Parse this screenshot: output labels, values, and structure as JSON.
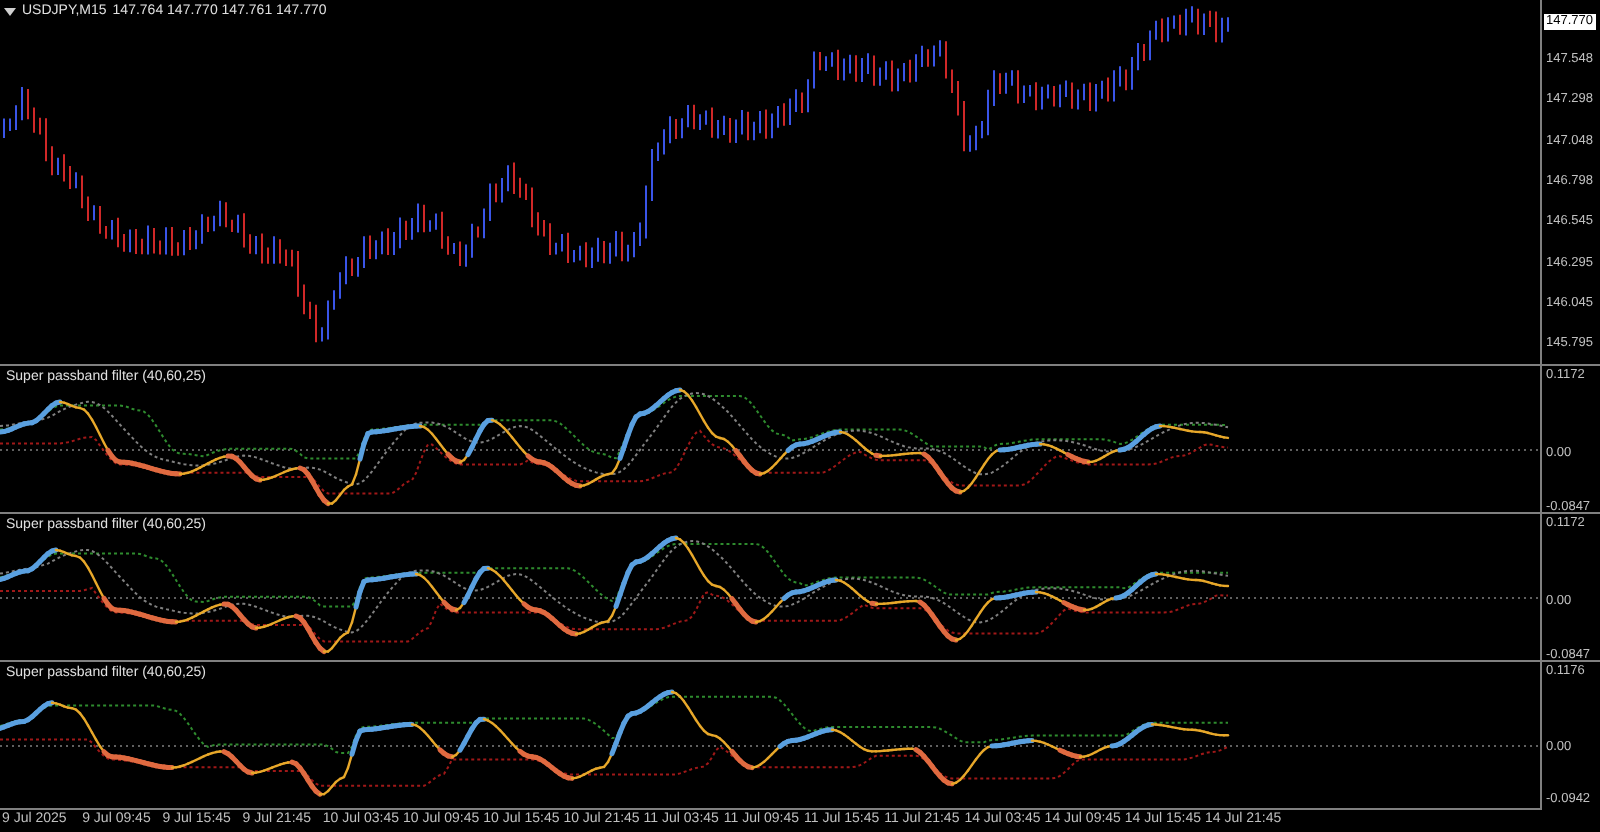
{
  "main_chart": {
    "symbol": "USDJPY,M15",
    "ohlc": "147.764 147.770 147.761 147.770",
    "current_price": "147.770",
    "price_axis": [
      "147.548",
      "147.298",
      "147.048",
      "146.798",
      "146.545",
      "146.295",
      "146.045",
      "145.795"
    ]
  },
  "indicator_panels": [
    {
      "title": "Super passband filter (40,60,25)",
      "axis": [
        "0.1172",
        "0.00",
        "-0.0847"
      ]
    },
    {
      "title": "Super passband filter (40,60,25)",
      "axis": [
        "0.1172",
        "0.00",
        "-0.0847"
      ]
    },
    {
      "title": "Super passband filter (40,60,25)",
      "axis": [
        "0.1176",
        "0.00",
        "-0.0942"
      ]
    }
  ],
  "time_axis": [
    "9 Jul 2025",
    "9 Jul 09:45",
    "9 Jul 15:45",
    "9 Jul 21:45",
    "10 Jul 03:45",
    "10 Jul 09:45",
    "10 Jul 15:45",
    "10 Jul 21:45",
    "11 Jul 03:45",
    "11 Jul 09:45",
    "11 Jul 15:45",
    "11 Jul 21:45",
    "14 Jul 03:45",
    "14 Jul 09:45",
    "14 Jul 15:45",
    "14 Jul 21:45"
  ]
}
